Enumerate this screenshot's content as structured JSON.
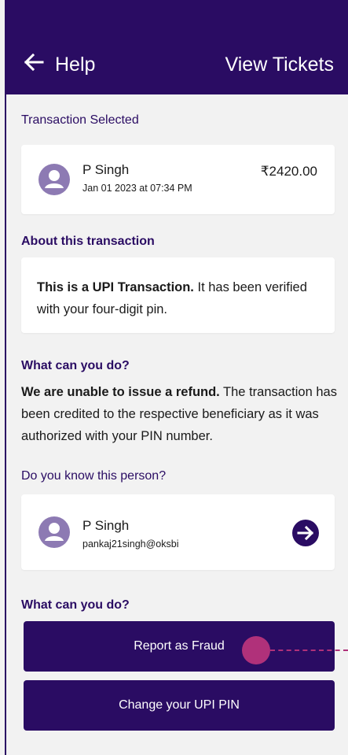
{
  "header": {
    "title": "Help",
    "view_tickets": "View Tickets",
    "background": "#2a0c63"
  },
  "transaction": {
    "section_label": "Transaction Selected",
    "name": "P Singh",
    "date": "Jan 01 2023 at 07:34 PM",
    "amount": "₹2420.00"
  },
  "about": {
    "section_label": "About this transaction",
    "bold_text": "This is a UPI Transaction.",
    "text": " It has been verified with your four-digit pin."
  },
  "what_can_do": {
    "section_label": "What can you do?",
    "bold_text": "We are unable to issue a refund.",
    "text": " The transaction has been credited to the respective beneficiary as it was authorized with your PIN number."
  },
  "know_person": {
    "section_label": "Do you know this person?",
    "name": "P Singh",
    "upi_id": "pankaj21singh@oksbi"
  },
  "actions": {
    "section_label": "What can you do?",
    "report_fraud": "Report as Fraud",
    "change_pin": "Change your UPI PIN"
  },
  "colors": {
    "primary": "#2a0c63",
    "avatar": "#8d7ab3",
    "touch_indicator": "#b0317a"
  },
  "icons": {
    "back": "arrow-left-icon",
    "avatar": "user-avatar-icon",
    "forward": "arrow-right-circle-icon"
  }
}
